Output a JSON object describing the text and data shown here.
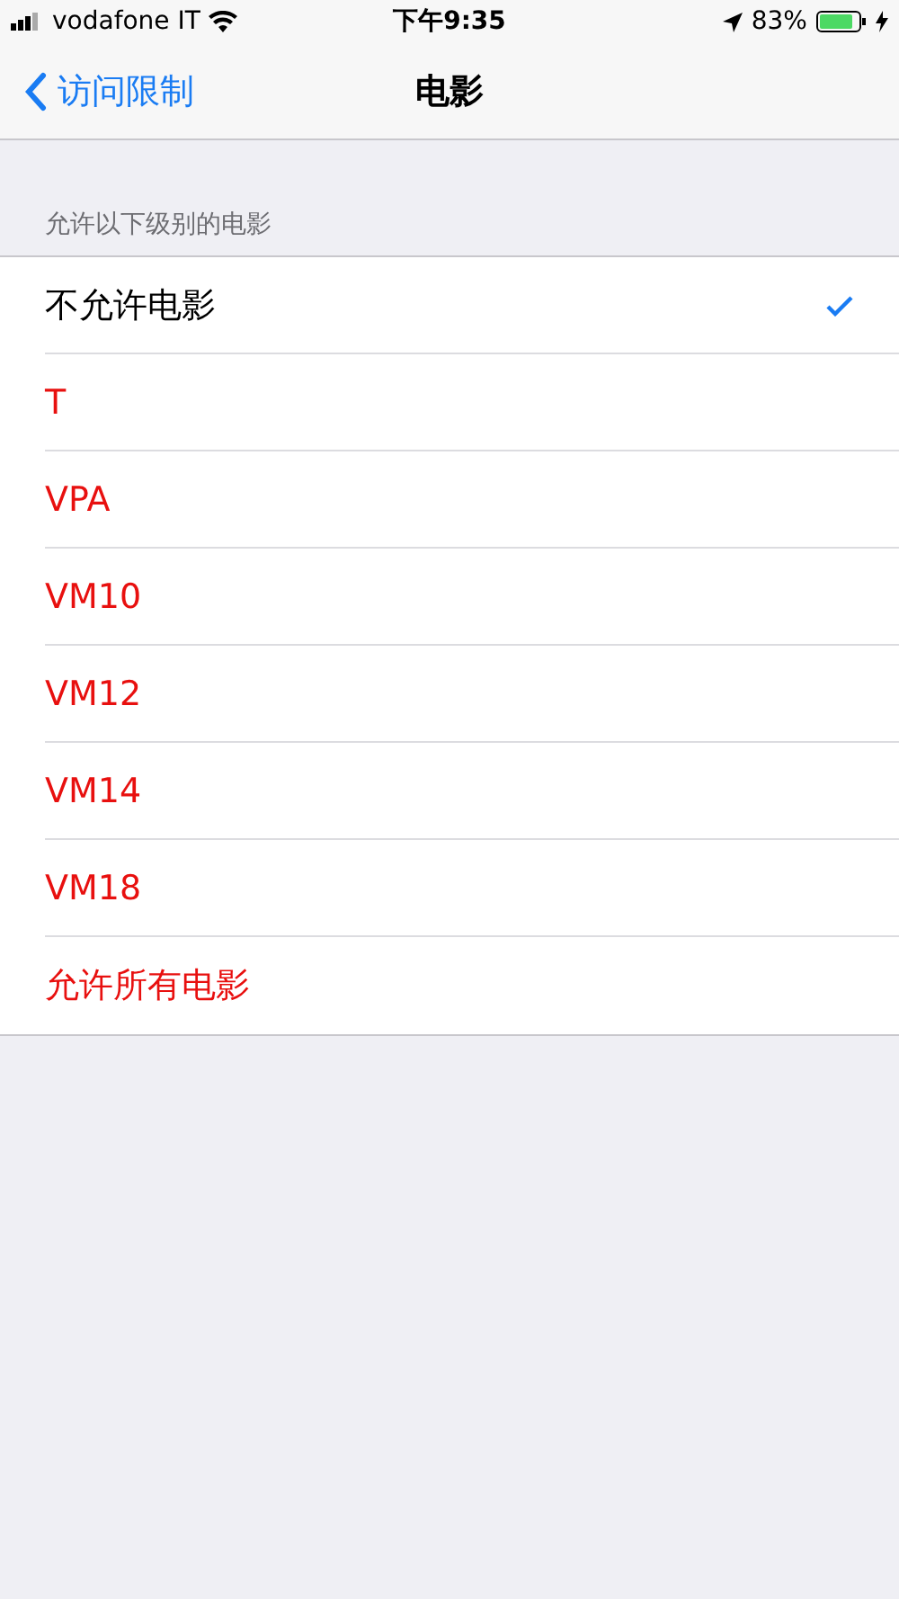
{
  "status_bar": {
    "carrier": "vodafone IT",
    "time": "下午9:35",
    "battery": "83%"
  },
  "nav": {
    "back": "访问限制",
    "title": "电影"
  },
  "section": {
    "header": "允许以下级别的电影"
  },
  "ratings": [
    {
      "label": "不允许电影",
      "selected": true,
      "restricted": false
    },
    {
      "label": "T",
      "selected": false,
      "restricted": true
    },
    {
      "label": "VPA",
      "selected": false,
      "restricted": true
    },
    {
      "label": "VM10",
      "selected": false,
      "restricted": true
    },
    {
      "label": "VM12",
      "selected": false,
      "restricted": true
    },
    {
      "label": "VM14",
      "selected": false,
      "restricted": true
    },
    {
      "label": "VM18",
      "selected": false,
      "restricted": true
    },
    {
      "label": "允许所有电影",
      "selected": false,
      "restricted": true
    }
  ]
}
